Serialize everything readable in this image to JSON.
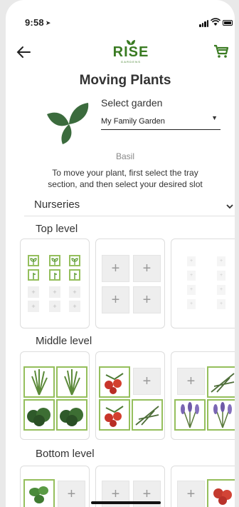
{
  "status": {
    "time": "9:58",
    "time_icon": "location-arrow"
  },
  "header": {
    "back_icon": "back-arrow-icon",
    "logo_text": "RISE",
    "logo_sub": "GARDENS",
    "cart_icon": "cart-icon",
    "brand_color": "#3a7b22"
  },
  "page": {
    "title": "Moving Plants",
    "select_label": "Select garden",
    "garden_value": "My Family Garden",
    "plant_name": "Basil",
    "instructions_line1": "To move your plant, first select the tray",
    "instructions_line2": "section, and then select your desired slot",
    "nurseries_label": "Nurseries"
  },
  "levels": {
    "top": {
      "label": "Top level"
    },
    "middle": {
      "label": "Middle level"
    },
    "bottom": {
      "label": "Bottom level"
    }
  },
  "slot_plus": "+",
  "colors": {
    "slot_border": "#95bf5c",
    "empty_slot": "#eeeeee"
  }
}
